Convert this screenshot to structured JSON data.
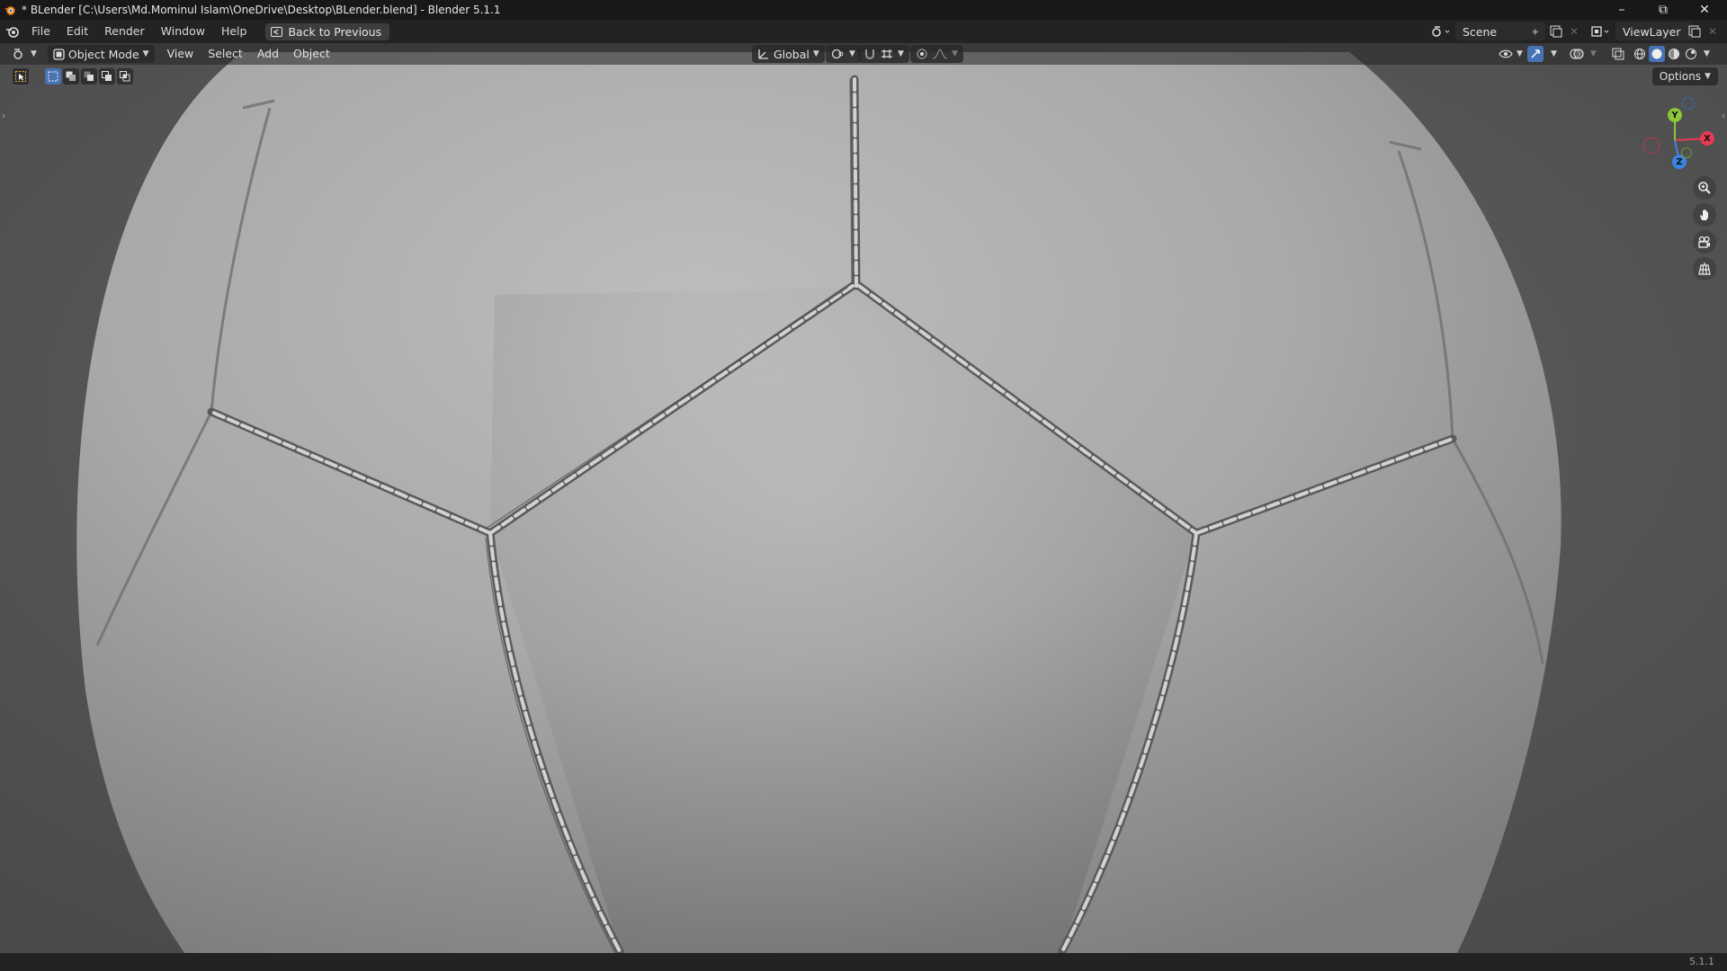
{
  "window": {
    "title": "* BLender [C:\\Users\\Md.Mominul Islam\\OneDrive\\Desktop\\BLender.blend] - Blender 5.1.1",
    "app_icon": "blender-logo-icon",
    "controls": [
      "minimize-icon",
      "restore-icon",
      "close-icon"
    ]
  },
  "topbar": {
    "menus": [
      "File",
      "Edit",
      "Render",
      "Window",
      "Help"
    ],
    "back_button": "Back to Previous",
    "scene_name": "Scene",
    "view_layer": "ViewLayer"
  },
  "viewport_header": {
    "mode": "Object Mode",
    "menus": [
      "View",
      "Select",
      "Add",
      "Object"
    ],
    "transform_orientation": "Global",
    "options_label": "Options"
  },
  "gizmo": {
    "axes": {
      "x": "X",
      "y": "Y",
      "z": "Z"
    },
    "colors": {
      "x": "#e53b52",
      "y": "#8bc63b",
      "z": "#3b84e5"
    }
  },
  "navigation": [
    "zoom-icon",
    "pan-hand-icon",
    "camera-view-icon",
    "ortho-grid-icon"
  ],
  "status": {
    "version": "5.1.1"
  },
  "colors": {
    "accent": "#4772b3",
    "viewport_bg": "#5a5a5a",
    "ball_surface": "#a8a8a8"
  }
}
